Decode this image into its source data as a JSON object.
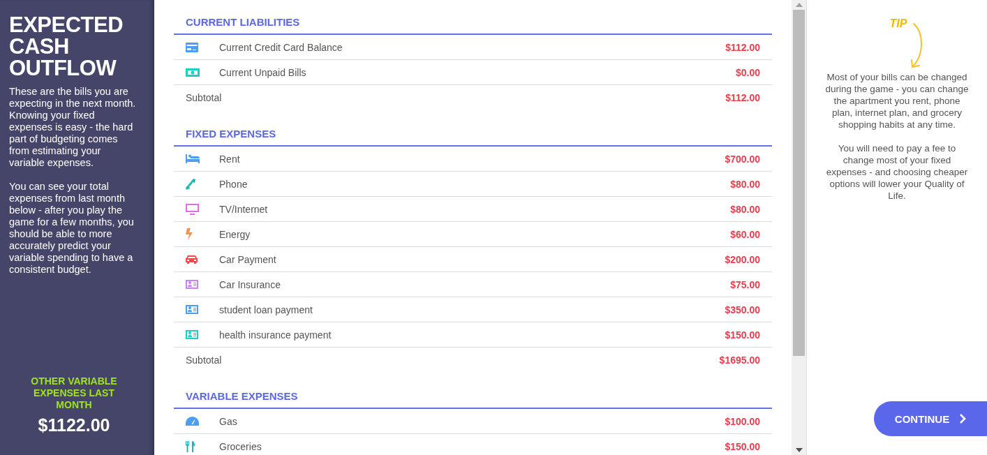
{
  "sidebar": {
    "title": "EXPECTED CASH OUTFLOW",
    "paragraphs": [
      "These are the bills you are expecting in the next month. Knowing your fixed expenses is easy - the hard part of budgeting comes from estimating your variable expenses.",
      "You can see your total expenses from last month below - after you play the game for a few months, you should be able to more accurately predict your variable spending to have a consistent budget."
    ],
    "stat_label": "OTHER VARIABLE EXPENSES LAST MONTH",
    "stat_value": "$1122.00"
  },
  "sections": [
    {
      "title": "CURRENT LIABILITIES",
      "rows": [
        {
          "kind": "card",
          "color": "#4d9ef0",
          "label": "Current Credit Card Balance",
          "amount": "$112.00"
        },
        {
          "kind": "cash",
          "color": "#1ccfc4",
          "label": "Current Unpaid Bills",
          "amount": "$0.00"
        }
      ],
      "subtotal_label": "Subtotal",
      "subtotal": "$112.00"
    },
    {
      "title": "FIXED EXPENSES",
      "rows": [
        {
          "kind": "bed",
          "color": "#4d9ef0",
          "label": "Rent",
          "amount": "$700.00"
        },
        {
          "kind": "phone",
          "color": "#1ab8b8",
          "label": "Phone",
          "amount": "$80.00"
        },
        {
          "kind": "tv",
          "color": "#e56ce8",
          "label": "TV/Internet",
          "amount": "$80.00"
        },
        {
          "kind": "bolt",
          "color": "#f5944a",
          "label": "Energy",
          "amount": "$60.00"
        },
        {
          "kind": "car",
          "color": "#ee4b4b",
          "label": "Car Payment",
          "amount": "$200.00"
        },
        {
          "kind": "idcard",
          "color": "#c784ec",
          "label": "Car Insurance",
          "amount": "$75.00"
        },
        {
          "kind": "idcard",
          "color": "#4d9ef0",
          "label": "student loan payment",
          "amount": "$350.00"
        },
        {
          "kind": "idcard",
          "color": "#1ccfc4",
          "label": "health insurance payment",
          "amount": "$150.00"
        }
      ],
      "subtotal_label": "Subtotal",
      "subtotal": "$1695.00"
    },
    {
      "title": "VARIABLE EXPENSES",
      "rows": [
        {
          "kind": "gauge",
          "color": "#4d9ef0",
          "label": "Gas",
          "amount": "$100.00"
        },
        {
          "kind": "utensils",
          "color": "#1ab8b8",
          "label": "Groceries",
          "amount": "$150.00"
        }
      ]
    }
  ],
  "tip": {
    "label": "TIP",
    "paragraphs": [
      "Most of your bills can be changed during the game - you can change the apartment you rent, phone plan, internet plan, and grocery shopping habits at any time.",
      "You will need to pay a fee to change most of your fixed expenses - and choosing cheaper options will lower your Quality of Life."
    ]
  },
  "continue_button": {
    "label": "CONTINUE"
  }
}
